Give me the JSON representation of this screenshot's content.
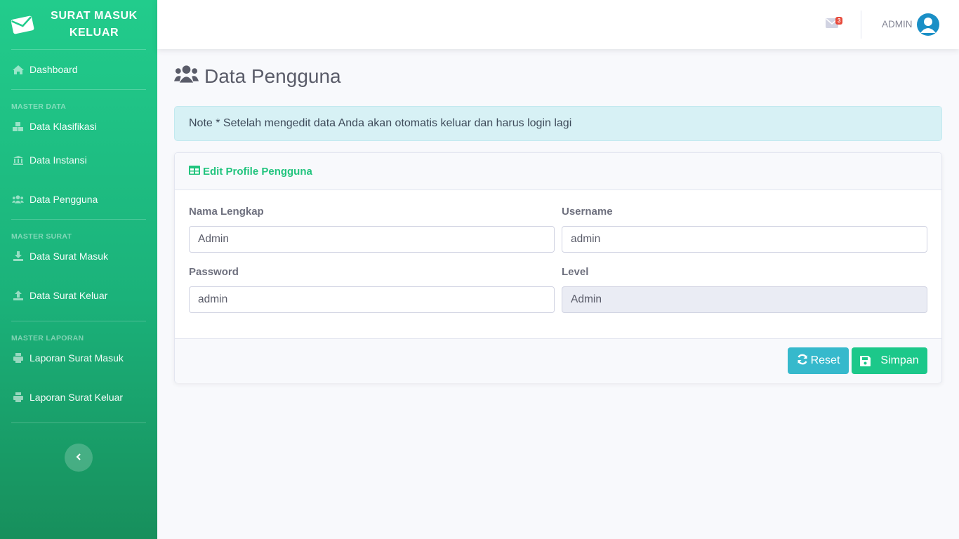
{
  "sidebar": {
    "brand": "SURAT MASUK KELUAR",
    "dashboard": "Dashboard",
    "sections": {
      "master_data": "MASTER DATA",
      "master_surat": "MASTER SURAT",
      "master_laporan": "MASTER LAPORAN"
    },
    "items": {
      "klasifikasi": "Data Klasifikasi",
      "instansi": "Data Instansi",
      "pengguna": "Data Pengguna",
      "surat_masuk": "Data Surat Masuk",
      "surat_keluar": "Data Surat Keluar",
      "laporan_masuk": "Laporan Surat Masuk",
      "laporan_keluar": "Laporan Surat Keluar"
    }
  },
  "topbar": {
    "mail_count": "3",
    "user": "ADMIN"
  },
  "page": {
    "title": "Data Pengguna",
    "note": "Note * Setelah mengedit data Anda akan otomatis keluar dan harus login lagi"
  },
  "form": {
    "header": "Edit Profile Pengguna",
    "nama_label": "Nama Lengkap",
    "nama_value": "Admin",
    "username_label": "Username",
    "username_value": "admin",
    "password_label": "Password",
    "password_value": "admin",
    "level_label": "Level",
    "level_value": "Admin",
    "reset_label": "Reset",
    "save_label": "Simpan"
  },
  "colors": {
    "sidebar_top": "#22cc8c",
    "sidebar_bottom": "#178f5c",
    "accent": "#1cc88a",
    "info": "#36b9cc",
    "badge": "#e74a3b"
  },
  "icons": {
    "brand": "envelope-icon",
    "dashboard": "home-icon",
    "klasifikasi": "cubes-icon",
    "instansi": "university-icon",
    "pengguna": "users-icon",
    "surat_masuk": "download-icon",
    "surat_keluar": "upload-icon",
    "laporan": "print-icon",
    "toggle": "chevron-left-icon",
    "mail": "envelope-icon",
    "avatar": "user-circle-icon",
    "reset": "sync-icon",
    "save": "save-icon",
    "form_header": "table-icon"
  }
}
